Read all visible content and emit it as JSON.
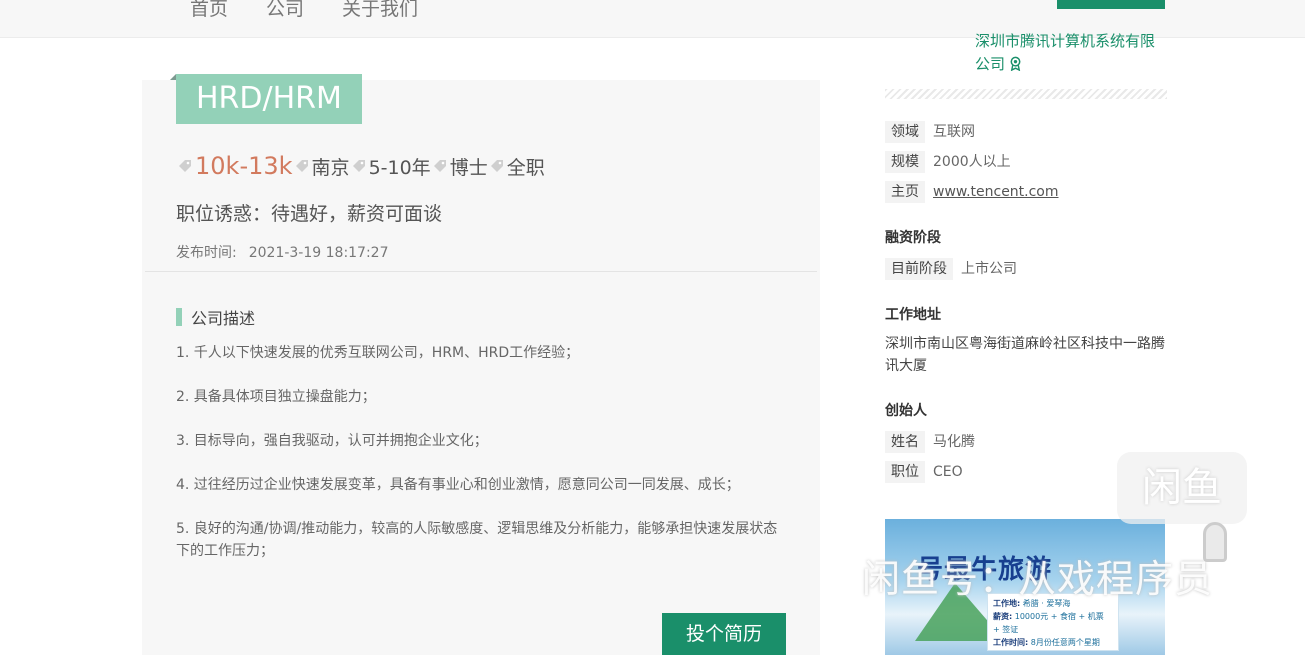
{
  "nav": {
    "items": [
      "首页",
      "公司",
      "关于我们"
    ]
  },
  "company": {
    "name": "深圳市腾讯计算机系统有限公司",
    "medal_icon": "award-icon"
  },
  "job": {
    "title": "HRD/HRM",
    "salary": "10k-13k",
    "city": "南京",
    "experience": "5-10年",
    "education": "博士",
    "type": "全职",
    "lure": "职位诱惑：待遇好，薪资可面谈",
    "pub_label": "发布时间:",
    "pub_time": "2021-3-19 18:17:27"
  },
  "description": {
    "heading": "公司描述",
    "items": [
      "1. 千人以下快速发展的优秀互联网公司，HRM、HRD工作经验；",
      "2. 具备具体项目独立操盘能力；",
      "3. 目标导向，强自我驱动，认可并拥抱企业文化；",
      "4. 过往经历过企业快速发展变革，具备有事业心和创业激情，愿意同公司一同发展、成长；",
      "5. 良好的沟通/协调/推动能力，较高的人际敏感度、逻辑思维及分析能力，能够承担快速发展状态下的工作压力；"
    ]
  },
  "apply_label": "投个简历",
  "sidebar": {
    "field_label": "领域",
    "field_value": "互联网",
    "scale_label": "规模",
    "scale_value": "2000人以上",
    "home_label": "主页",
    "home_value": "www.tencent.com",
    "funding_heading": "融资阶段",
    "stage_label": "目前阶段",
    "stage_value": "上市公司",
    "address_heading": "工作地址",
    "address": "深圳市南山区粤海街道麻岭社区科技中一路腾讯大厦",
    "founder_heading": "创始人",
    "name_label": "姓名",
    "name_value": "马化腾",
    "position_label": "职位",
    "position_value": "CEO"
  },
  "ad": {
    "title": "号最牛旅游",
    "line1_label": "工作地:",
    "line1_value": "希腊 · 爱琴海",
    "line2_label": "薪资:",
    "line2_value": "10000元 + 食宿 + 机票 + 签证",
    "line3_label": "工作时间:",
    "line3_value": "8月份任意两个星期"
  },
  "watermark": {
    "logo": "闲鱼",
    "text": "闲鱼号：从戏程序员"
  },
  "colors": {
    "accent": "#1a8f6a",
    "tag": "#93d1b8",
    "salary": "#d27a5e"
  }
}
